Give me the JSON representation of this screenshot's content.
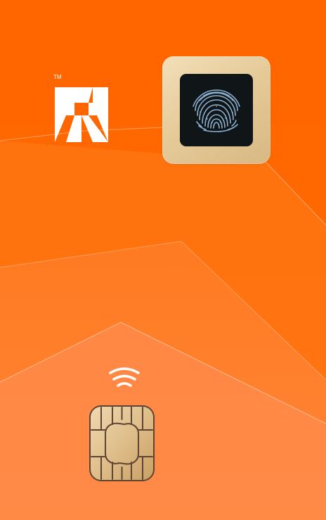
{
  "card": {
    "trademark": "TM",
    "colors": {
      "orange_top": "#ff6a00",
      "orange_mid": "#ff7a18",
      "orange_bottom": "#ff8a45",
      "white": "#ffffff",
      "sensor_gold": "#e6cb9a",
      "sensor_pad": "#101518",
      "fingerprint_blue": "#8fb7d6",
      "chip_gold": "#d8b47d"
    },
    "icons": {
      "logo": "brand-logo-icon",
      "fingerprint": "fingerprint-icon",
      "contactless": "contactless-icon",
      "chip": "emv-chip-icon"
    }
  }
}
